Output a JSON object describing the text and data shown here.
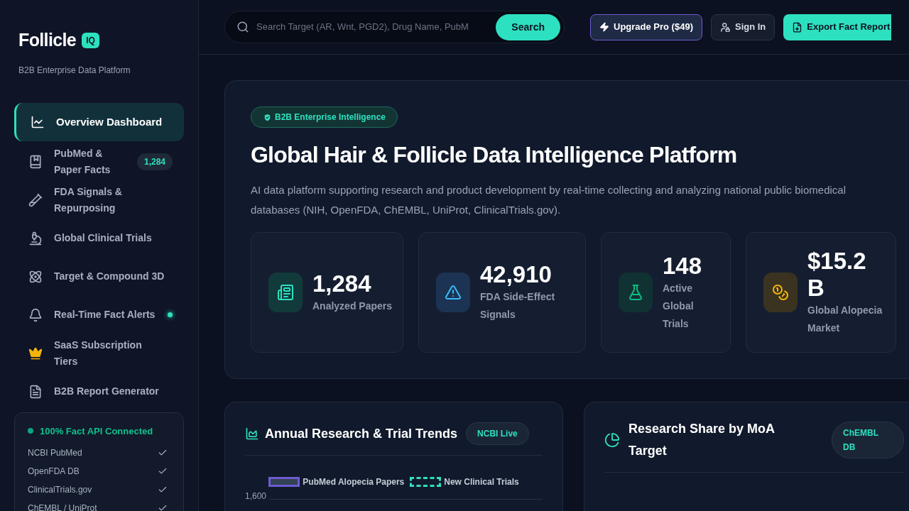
{
  "brand": {
    "name": "Follicle",
    "badge": "IQ",
    "subtitle": "B2B Enterprise Data Platform"
  },
  "nav": [
    {
      "kind": "chart",
      "label": "Overview Dashboard",
      "selected": true
    },
    {
      "kind": "book",
      "label": "PubMed & Paper Facts",
      "selected": false,
      "count": "1,284"
    },
    {
      "kind": "vial",
      "label": "FDA Signals & Repurposing",
      "selected": false
    },
    {
      "kind": "microscope",
      "label": "Global Clinical Trials",
      "selected": false
    },
    {
      "kind": "atom",
      "label": "Target & Compound 3D",
      "selected": false
    },
    {
      "kind": "bell",
      "label": "Real-Time Fact Alerts",
      "selected": false,
      "live": true
    },
    {
      "kind": "crown",
      "label": "SaaS Subscription Tiers",
      "selected": false
    },
    {
      "kind": "invoice",
      "label": "B2B Report Generator",
      "selected": false
    }
  ],
  "api_status": {
    "title": "100% Fact API Connected",
    "sources": [
      {
        "name": "NCBI PubMed",
        "checked": true
      },
      {
        "name": "OpenFDA DB",
        "checked": true
      },
      {
        "name": "ClinicalTrials.gov",
        "checked": true
      },
      {
        "name": "ChEMBL / UniProt",
        "checked": true
      }
    ]
  },
  "header": {
    "search": {
      "placeholder": "Search Target (AR, Wnt, PGD2), Drug Name, PubM",
      "button": "Search"
    },
    "upgrade": "Upgrade Pro ($49)",
    "sign_in": "Sign In",
    "export": "Export Fact Report"
  },
  "hero": {
    "badge": "B2B Enterprise Intelligence",
    "title": "Global Hair & Follicle Data Intelligence Platform",
    "description": "AI data platform supporting research and product development by real-time collecting and analyzing national public biomedical databases (NIH, OpenFDA, ChEMBL, UniProt, ClinicalTrials.gov).",
    "stats": [
      {
        "kind": "papers",
        "value": "1,284",
        "label": "Analyzed Papers"
      },
      {
        "kind": "warning",
        "value": "42,910",
        "label": "FDA Side-Effect Signals"
      },
      {
        "kind": "flask",
        "value": "148",
        "label": "Active Global Trials"
      },
      {
        "kind": "coins",
        "value": "$15.2 B",
        "label": "Global Alopecia Market"
      }
    ]
  },
  "trends": {
    "title": "Annual Research & Trial Trends",
    "tag": "NCBI Live",
    "legend": [
      {
        "kind": "solid",
        "label": "PubMed Alopecia Papers",
        "color": "#6d5bd0"
      },
      {
        "kind": "dashed",
        "label": "New Clinical Trials",
        "color": "#2de0c0"
      }
    ],
    "y_tick": "1,600"
  },
  "share": {
    "title": "Research Share by MoA Target",
    "tag": "ChEMBL DB"
  }
}
